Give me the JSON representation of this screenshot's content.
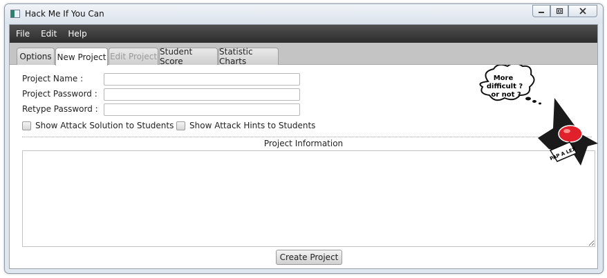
{
  "window": {
    "title": "Hack Me If You Can",
    "controls": [
      "minimize",
      "restore",
      "close"
    ]
  },
  "menubar": {
    "items": [
      "File",
      "Edit",
      "Help"
    ]
  },
  "tabs": [
    {
      "label": "Options",
      "state": "normal"
    },
    {
      "label": "New Project",
      "state": "active"
    },
    {
      "label": "Edit Project",
      "state": "disabled"
    },
    {
      "label": "Student Score",
      "state": "normal"
    },
    {
      "label": "Statistic Charts",
      "state": "normal"
    }
  ],
  "form": {
    "project_name_label": "Project Name :",
    "project_name_value": "",
    "project_password_label": "Project Password :",
    "project_password_value": "",
    "retype_password_label": "Retype Password :",
    "retype_password_value": "",
    "show_solution_label": "Show Attack Solution to Students",
    "show_solution_checked": false,
    "show_hints_label": "Show Attack Hints to Students",
    "show_hints_checked": false
  },
  "project_info": {
    "title": "Project Information",
    "text": ""
  },
  "create_button_label": "Create Project",
  "mascot": {
    "bubble_line1": "More",
    "bubble_line2": "difficult ?",
    "bubble_line3": "or not ?",
    "badge_text": "PAP A LEX"
  },
  "colors": {
    "menubar": "#3d3d3d",
    "tabbar": "#c4c4c4",
    "mascot_accent": "#e0202a"
  }
}
